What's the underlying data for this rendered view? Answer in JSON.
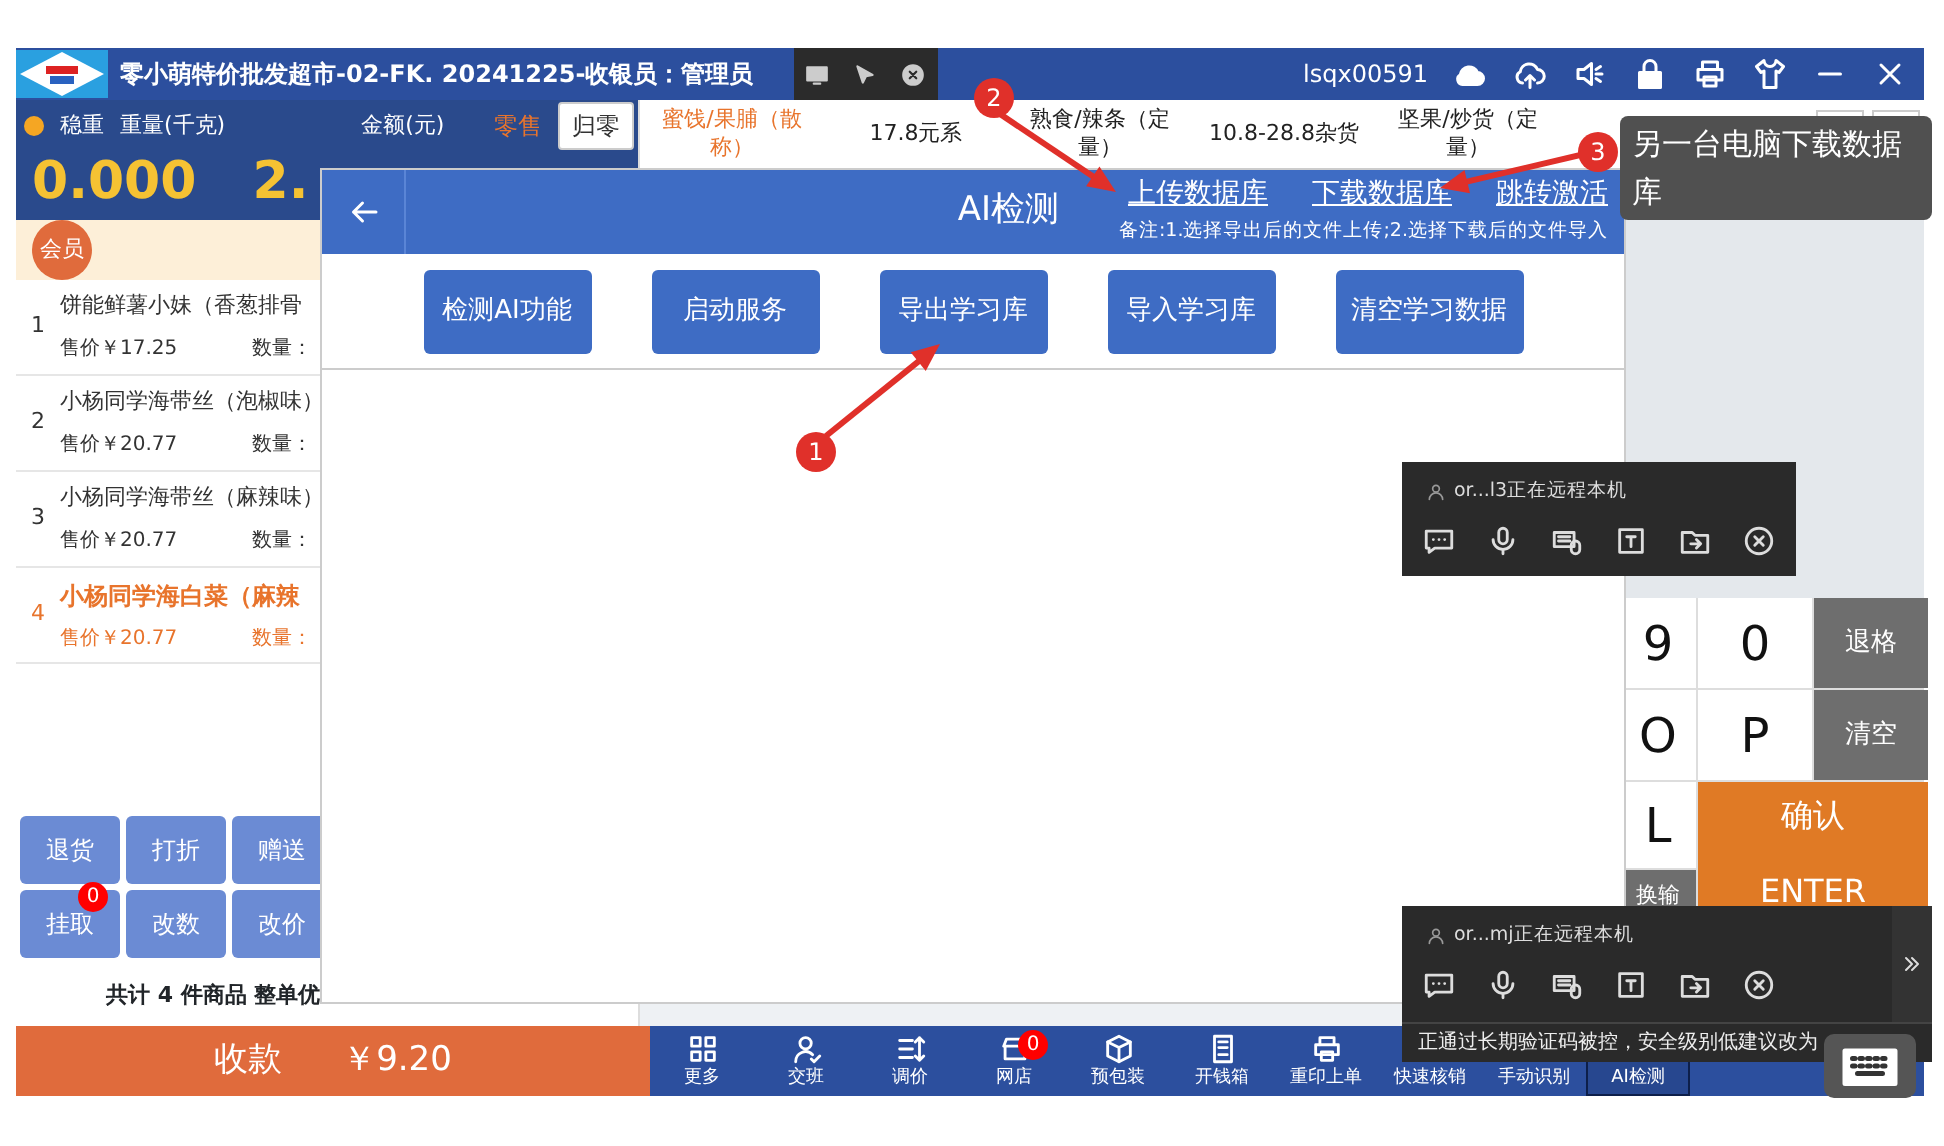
{
  "title_bar": {
    "title": "零小萌特价批发超市-02-FK. 20241225-收银员：管理员",
    "account": "lsqx00591"
  },
  "scale": {
    "status": "稳重",
    "weight_label": "重量(千克)",
    "amount_label": "金额(元)",
    "mode": "零售",
    "weight": "0.000",
    "amount": "2.",
    "zero_button": "归零"
  },
  "categories": [
    {
      "label": "蜜饯/果脯（散称）",
      "selected": true
    },
    {
      "label": "17.8元系",
      "selected": false
    },
    {
      "label": "熟食/辣条（定量）",
      "selected": false
    },
    {
      "label": "10.8-28.8杂货",
      "selected": false
    },
    {
      "label": "坚果/炒货（定量）",
      "selected": false
    }
  ],
  "member_button": "会员",
  "cart_items": [
    {
      "index": "1",
      "name": "饼能鲜薯小妹（香葱排骨",
      "price": "售价￥17.25",
      "qty_label": "数量：",
      "selected": false
    },
    {
      "index": "2",
      "name": "小杨同学海带丝（泡椒味）",
      "price": "售价￥20.77",
      "qty_label": "数量：",
      "selected": false
    },
    {
      "index": "3",
      "name": "小杨同学海带丝（麻辣味）",
      "price": "售价￥20.77",
      "qty_label": "数量：",
      "selected": false
    },
    {
      "index": "4",
      "name": "小杨同学海白菜（麻辣",
      "price": "售价￥20.77",
      "qty_label": "数量：",
      "selected": true
    }
  ],
  "actions": [
    {
      "label": "退货"
    },
    {
      "label": "打折"
    },
    {
      "label": "赠送"
    },
    {
      "label": "挂取",
      "badge": "0"
    },
    {
      "label": "改数"
    },
    {
      "label": "改价"
    }
  ],
  "summary": "共计 4 件商品 整单优",
  "checkout": {
    "label": "收款",
    "amount": "￥9.20"
  },
  "toolbar": [
    {
      "label": "更多",
      "selected": false
    },
    {
      "label": "交班",
      "selected": false
    },
    {
      "label": "调价",
      "selected": false
    },
    {
      "label": "网店",
      "selected": false,
      "badge": "0"
    },
    {
      "label": "预包装",
      "selected": false
    },
    {
      "label": "开钱箱",
      "selected": false
    },
    {
      "label": "重印上单",
      "selected": false
    },
    {
      "label": "快速核销",
      "selected": false
    },
    {
      "label": "手动识别",
      "selected": false
    },
    {
      "label": "AI检测",
      "selected": true
    }
  ],
  "keypad": [
    {
      "label": "9",
      "kind": "char"
    },
    {
      "label": "0",
      "kind": "char"
    },
    {
      "label": "退格",
      "kind": "function"
    },
    {
      "label": "O",
      "kind": "char"
    },
    {
      "label": "P",
      "kind": "char"
    },
    {
      "label": "清空",
      "kind": "function"
    },
    {
      "label": "L",
      "kind": "char"
    },
    {
      "label": "换输",
      "kind": "function"
    },
    {
      "label": "确认",
      "sublabel": "ENTER",
      "kind": "confirm"
    }
  ],
  "dialog": {
    "title": "AI检测",
    "links": [
      "上传数据库",
      "下载数据库",
      "跳转激活"
    ],
    "note": "备注:1.选择导出后的文件上传;2.选择下载后的文件导入",
    "buttons": [
      "检测AI功能",
      "启动服务",
      "导出学习库",
      "导入学习库",
      "清空学习数据"
    ]
  },
  "remote_sessions": [
    {
      "user": "or...l3正在远程本机"
    },
    {
      "user": "or...mj正在远程本机",
      "warning": "正通过长期验证码被控，安全级别低建议改为"
    }
  ],
  "annotations": [
    {
      "number": "1"
    },
    {
      "number": "2"
    },
    {
      "number": "3",
      "note": "另一台电脑下载数据库"
    }
  ]
}
